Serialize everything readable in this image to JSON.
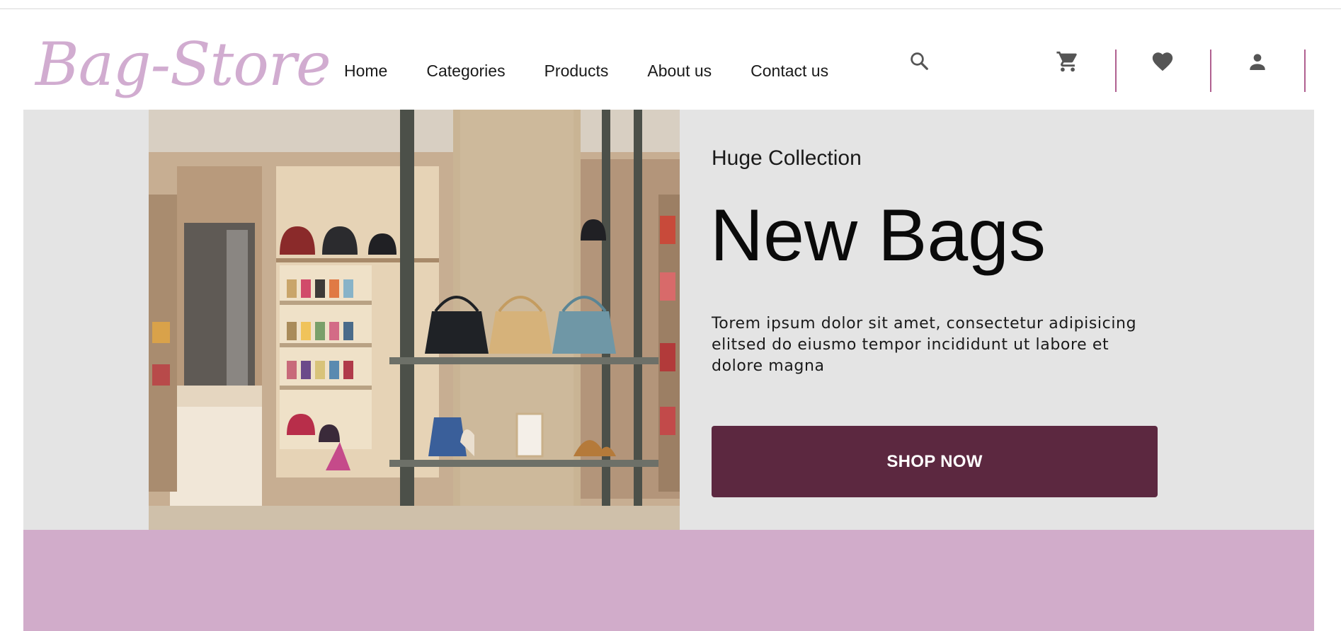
{
  "brand": {
    "logo_text": "Bag-Store",
    "logo_color": "#d1acd0"
  },
  "nav": {
    "items": [
      {
        "label": "Home"
      },
      {
        "label": "Categories"
      },
      {
        "label": "Products"
      },
      {
        "label": "About us"
      },
      {
        "label": "Contact us"
      }
    ]
  },
  "header_icons": [
    "search-icon",
    "cart-icon",
    "heart-icon",
    "user-icon"
  ],
  "hero": {
    "eyebrow": "Huge Collection",
    "headline": "New Bags",
    "description": "Torem ipsum dolor sit amet, consectetur adipisicing elitsed do eiusmo tempor incididunt ut labore et dolore magna",
    "cta_label": "SHOP NOW",
    "background_color": "#e4e4e4",
    "cta_color": "#5c2840",
    "image_subject": "bag store interior with handbags on shelves"
  },
  "colors": {
    "accent_band": "#d1acca",
    "separator": "#b06090"
  }
}
